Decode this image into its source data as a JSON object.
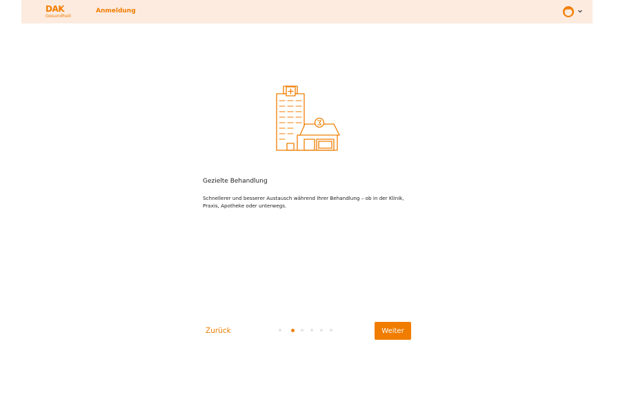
{
  "header": {
    "logo_text": "DAK",
    "logo_sub": "Gesundheit",
    "title": "Anmeldung",
    "avatar_icon": "user-avatar-icon",
    "chevron": "⌄"
  },
  "slide": {
    "heading": "Gezielte Behandlung",
    "description": "Schnellerer und besserer Austausch während Ihrer Behandlung – ob in der Klinik, Praxis, Apotheke oder unterwegs.",
    "illustration_icon": "hospital-pharmacy-icon"
  },
  "pager": {
    "total": 6,
    "current": 2
  },
  "buttons": {
    "back": "Zurück",
    "next": "Weiter"
  },
  "colors": {
    "accent": "#f07d00",
    "header_bg": "#fdebe0",
    "dot_inactive": "#e4e4e4"
  }
}
